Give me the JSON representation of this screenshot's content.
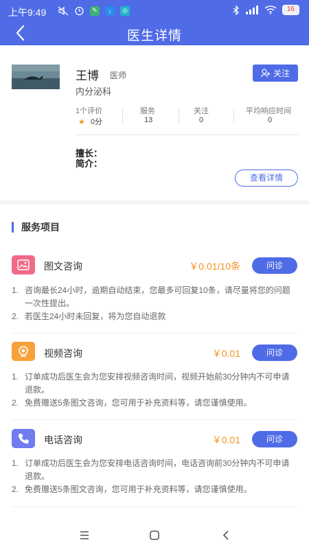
{
  "status_bar": {
    "time": "上午9:49",
    "battery": "16"
  },
  "header": {
    "title": "医生详情"
  },
  "doctor": {
    "name": "王博",
    "title": "医师",
    "department": "内分泌科",
    "follow_label": "关注",
    "stats": [
      {
        "label": "1个评价",
        "value": "0分"
      },
      {
        "label": "服务",
        "value": "13"
      },
      {
        "label": "关注",
        "value": "0"
      },
      {
        "label": "平均响应时间",
        "value": "0"
      }
    ],
    "expertise_label": "擅长：",
    "intro_label": "简介：",
    "detail_button": "查看详情"
  },
  "services": {
    "section_title": "服务项目",
    "items": [
      {
        "name": "图文咨询",
        "price": "￥0.01/10条",
        "button": "问诊",
        "icon": "image-text-icon",
        "icon_color": "#f06a86",
        "notes": [
          {
            "idx": "1.",
            "text": "咨询最长24小时，逾期自动结束，您最多可回复10条，请尽量将您的问题一次性提出。"
          },
          {
            "idx": "2.",
            "text": "若医生24小时未回复，将为您自动退款"
          }
        ]
      },
      {
        "name": "视频咨询",
        "price": "￥0.01",
        "button": "问诊",
        "icon": "video-camera-icon",
        "icon_color": "#f7a13a",
        "notes": [
          {
            "idx": "1.",
            "text": "订单成功后医生会为您安排视频咨询时间，视频开始前30分钟内不可申请退款。"
          },
          {
            "idx": "2.",
            "text": "免费赠送5条图文咨询，您可用于补充资料等，请您谨慎使用。"
          }
        ]
      },
      {
        "name": "电话咨询",
        "price": "￥0.01",
        "button": "问诊",
        "icon": "phone-icon",
        "icon_color": "#6f7cf0",
        "notes": [
          {
            "idx": "1.",
            "text": "订单成功后医生会为您安排电话咨询时间，电话咨询前30分钟内不可申请退款。"
          },
          {
            "idx": "2.",
            "text": "免费赠送5条图文咨询，您可用于补充资料等，请您谨慎使用。"
          }
        ]
      }
    ]
  },
  "colors": {
    "brand": "#4f6be6",
    "price": "#f39321",
    "star": "#f39321"
  }
}
